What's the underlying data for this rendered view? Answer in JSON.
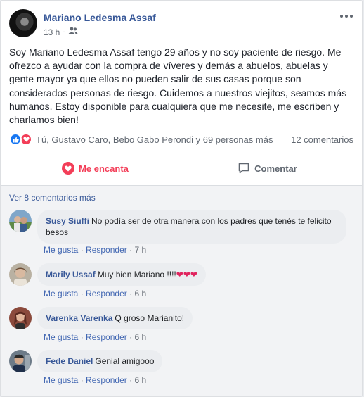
{
  "post": {
    "author": "Mariano Ledesma Assaf",
    "time": "13 h",
    "text": "Soy Mariano Ledesma Assaf tengo 29 años y no soy paciente de riesgo. Me ofrezco a ayudar con la compra de víveres y demás a abuelos, abuelas y gente mayor ya que ellos no pueden salir de sus casas porque son considerados personas de riesgo. Cuidemos a nuestros viejitos, seamos más humanos. Estoy disponible para cualquiera que me necesite, me escriben y charlamos bien!",
    "reactors": "Tú, Gustavo Caro, Bebo Gabo Perondi y 69 personas más",
    "comments_count": "12 comentarios"
  },
  "actions": {
    "love_label": "Me encanta",
    "comment_label": "Comentar"
  },
  "comments_section": {
    "view_more": "Ver 8 comentarios más",
    "like_label": "Me gusta",
    "reply_label": "Responder",
    "separator": "·"
  },
  "comments": [
    {
      "name": "Susy Siuffi",
      "text": "No podía ser de otra manera con los padres que tenés te felicito besos",
      "time": "7 h"
    },
    {
      "name": "Marily Ussaf",
      "text": "Muy bien Mariano !!!!",
      "emoji": "❤❤❤",
      "time": "6 h"
    },
    {
      "name": "Varenka Varenka",
      "text": "Q groso Marianito!",
      "time": "6 h"
    },
    {
      "name": "Fede Daniel",
      "text": "Genial amigooo",
      "time": "6 h"
    }
  ],
  "colors": {
    "link_blue": "#385898",
    "love_red": "#f33e58",
    "like_blue": "#1877f2"
  }
}
